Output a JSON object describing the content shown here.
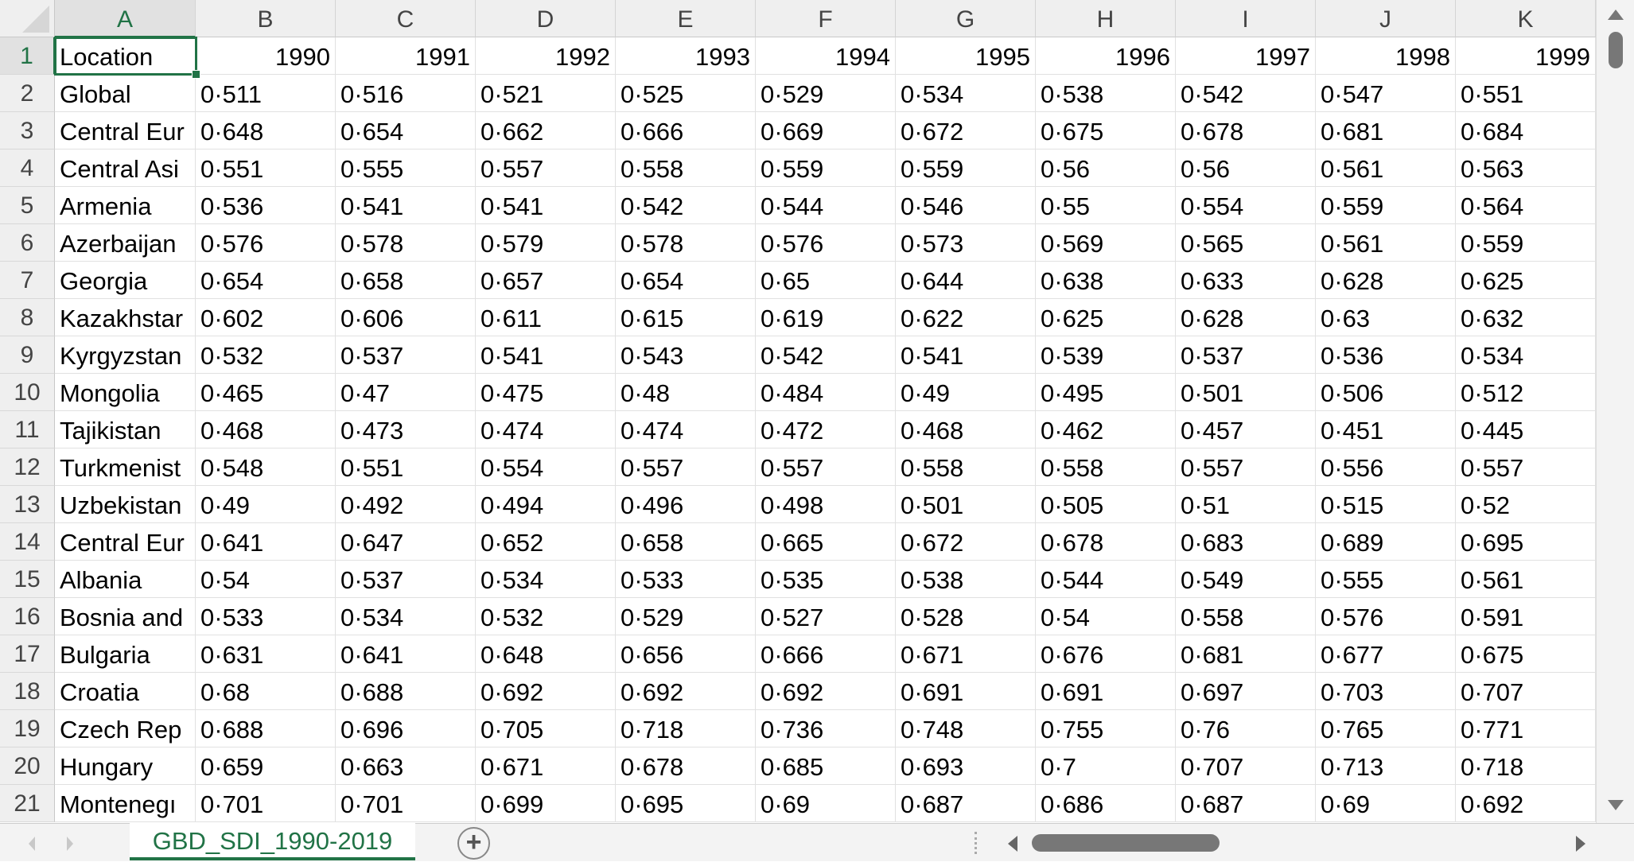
{
  "columns": [
    "A",
    "B",
    "C",
    "D",
    "E",
    "F",
    "G",
    "H",
    "I",
    "J",
    "K"
  ],
  "active_cell": "A1",
  "header_row": [
    "Location",
    "1990",
    "1991",
    "1992",
    "1993",
    "1994",
    "1995",
    "1996",
    "1997",
    "1998",
    "1999"
  ],
  "rows": [
    {
      "n": "2",
      "label": "Global",
      "v": [
        "0·511",
        "0·516",
        "0·521",
        "0·525",
        "0·529",
        "0·534",
        "0·538",
        "0·542",
        "0·547",
        "0·551"
      ]
    },
    {
      "n": "3",
      "label": "Central Eur",
      "v": [
        "0·648",
        "0·654",
        "0·662",
        "0·666",
        "0·669",
        "0·672",
        "0·675",
        "0·678",
        "0·681",
        "0·684"
      ]
    },
    {
      "n": "4",
      "label": "Central Asi",
      "v": [
        "0·551",
        "0·555",
        "0·557",
        "0·558",
        "0·559",
        "0·559",
        "0·56",
        "0·56",
        "0·561",
        "0·563"
      ]
    },
    {
      "n": "5",
      "label": "Armenia",
      "v": [
        "0·536",
        "0·541",
        "0·541",
        "0·542",
        "0·544",
        "0·546",
        "0·55",
        "0·554",
        "0·559",
        "0·564"
      ]
    },
    {
      "n": "6",
      "label": "Azerbaijan",
      "v": [
        "0·576",
        "0·578",
        "0·579",
        "0·578",
        "0·576",
        "0·573",
        "0·569",
        "0·565",
        "0·561",
        "0·559"
      ]
    },
    {
      "n": "7",
      "label": "Georgia",
      "v": [
        "0·654",
        "0·658",
        "0·657",
        "0·654",
        "0·65",
        "0·644",
        "0·638",
        "0·633",
        "0·628",
        "0·625"
      ]
    },
    {
      "n": "8",
      "label": "Kazakhstar",
      "v": [
        "0·602",
        "0·606",
        "0·611",
        "0·615",
        "0·619",
        "0·622",
        "0·625",
        "0·628",
        "0·63",
        "0·632"
      ]
    },
    {
      "n": "9",
      "label": "Kyrgyzstan",
      "v": [
        "0·532",
        "0·537",
        "0·541",
        "0·543",
        "0·542",
        "0·541",
        "0·539",
        "0·537",
        "0·536",
        "0·534"
      ]
    },
    {
      "n": "10",
      "label": "Mongolia",
      "v": [
        "0·465",
        "0·47",
        "0·475",
        "0·48",
        "0·484",
        "0·49",
        "0·495",
        "0·501",
        "0·506",
        "0·512"
      ]
    },
    {
      "n": "11",
      "label": "Tajikistan",
      "v": [
        "0·468",
        "0·473",
        "0·474",
        "0·474",
        "0·472",
        "0·468",
        "0·462",
        "0·457",
        "0·451",
        "0·445"
      ]
    },
    {
      "n": "12",
      "label": "Turkmenist",
      "v": [
        "0·548",
        "0·551",
        "0·554",
        "0·557",
        "0·557",
        "0·558",
        "0·558",
        "0·557",
        "0·556",
        "0·557"
      ]
    },
    {
      "n": "13",
      "label": "Uzbekistan",
      "v": [
        "0·49",
        "0·492",
        "0·494",
        "0·496",
        "0·498",
        "0·501",
        "0·505",
        "0·51",
        "0·515",
        "0·52"
      ]
    },
    {
      "n": "14",
      "label": "Central Eur",
      "v": [
        "0·641",
        "0·647",
        "0·652",
        "0·658",
        "0·665",
        "0·672",
        "0·678",
        "0·683",
        "0·689",
        "0·695"
      ]
    },
    {
      "n": "15",
      "label": "Albania",
      "v": [
        "0·54",
        "0·537",
        "0·534",
        "0·533",
        "0·535",
        "0·538",
        "0·544",
        "0·549",
        "0·555",
        "0·561"
      ]
    },
    {
      "n": "16",
      "label": "Bosnia and",
      "v": [
        "0·533",
        "0·534",
        "0·532",
        "0·529",
        "0·527",
        "0·528",
        "0·54",
        "0·558",
        "0·576",
        "0·591"
      ]
    },
    {
      "n": "17",
      "label": "Bulgaria",
      "v": [
        "0·631",
        "0·641",
        "0·648",
        "0·656",
        "0·666",
        "0·671",
        "0·676",
        "0·681",
        "0·677",
        "0·675"
      ]
    },
    {
      "n": "18",
      "label": "Croatia",
      "v": [
        "0·68",
        "0·688",
        "0·692",
        "0·692",
        "0·692",
        "0·691",
        "0·691",
        "0·697",
        "0·703",
        "0·707"
      ]
    },
    {
      "n": "19",
      "label": "Czech Rep",
      "v": [
        "0·688",
        "0·696",
        "0·705",
        "0·718",
        "0·736",
        "0·748",
        "0·755",
        "0·76",
        "0·765",
        "0·771"
      ]
    },
    {
      "n": "20",
      "label": "Hungary",
      "v": [
        "0·659",
        "0·663",
        "0·671",
        "0·678",
        "0·685",
        "0·693",
        "0·7",
        "0·707",
        "0·713",
        "0·718"
      ]
    },
    {
      "n": "21",
      "label": "Montenegı",
      "v": [
        "0·701",
        "0·701",
        "0·699",
        "0·695",
        "0·69",
        "0·687",
        "0·686",
        "0·687",
        "0·69",
        "0·692"
      ]
    }
  ],
  "sheet_tab": "GBD_SDI_1990-2019",
  "add_sheet_icon": "+",
  "accent_color": "#217346"
}
